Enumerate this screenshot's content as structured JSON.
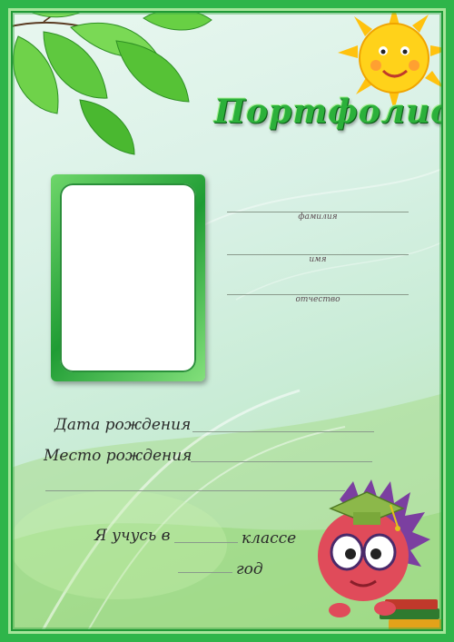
{
  "title": "Портфолио",
  "fields": {
    "surname": "фамилия",
    "name": "имя",
    "patronymic": "отчество"
  },
  "birth": {
    "date_label": "Дата рождения",
    "place_label": "Место рождения"
  },
  "school": {
    "study_label": "Я учусь в",
    "class_label": "классе",
    "year_label": "год"
  },
  "colors": {
    "frame_green": "#2fb54a",
    "title_green": "#2bb03a",
    "sun_yellow": "#ffd21a"
  },
  "icons": [
    "leaves-decoration",
    "sun-character",
    "hedgehog-character",
    "graduation-cap",
    "books-stack"
  ]
}
